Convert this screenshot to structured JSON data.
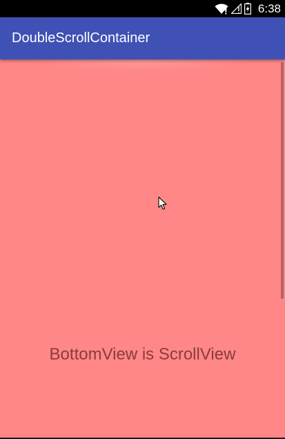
{
  "status_bar": {
    "time": "6:38",
    "icons": [
      "wifi-icon",
      "signal-icon",
      "battery-icon"
    ]
  },
  "app_bar": {
    "title": "DoubleScrollContainer",
    "color": "#3f51b5"
  },
  "content": {
    "background": "#ff8787",
    "bottom_view_text": "BottomView is ScrollView"
  }
}
